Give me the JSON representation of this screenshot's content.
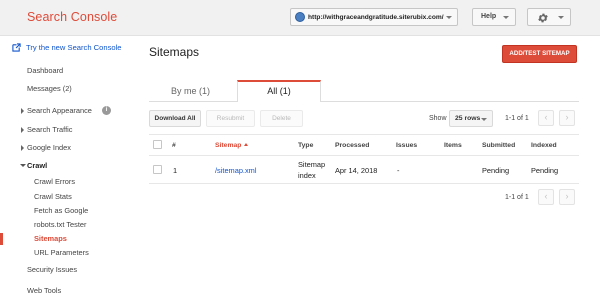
{
  "header": {
    "brand": "Search Console",
    "site_url": "http://withgraceandgratitude.siterubix.com/",
    "help_label": "Help"
  },
  "sidebar": {
    "try_new": "Try the new Search Console",
    "items": [
      {
        "label": "Dashboard"
      },
      {
        "label": "Messages (2)"
      },
      {
        "label": "Search Appearance"
      },
      {
        "label": "Search Traffic"
      },
      {
        "label": "Google Index"
      },
      {
        "label": "Crawl"
      },
      {
        "label": "Crawl Errors"
      },
      {
        "label": "Crawl Stats"
      },
      {
        "label": "Fetch as Google"
      },
      {
        "label": "robots.txt Tester"
      },
      {
        "label": "Sitemaps"
      },
      {
        "label": "URL Parameters"
      },
      {
        "label": "Security Issues"
      },
      {
        "label": "Web Tools"
      }
    ]
  },
  "main": {
    "title": "Sitemaps",
    "add_test_label": "ADD/TEST SITEMAP",
    "tabs": [
      {
        "label": "By me (1)"
      },
      {
        "label": "All (1)"
      }
    ],
    "toolbar": {
      "download_all": "Download All",
      "resubmit": "Resubmit",
      "delete": "Delete",
      "show_label": "Show",
      "rows_value": "25 rows",
      "pager_text": "1-1 of 1"
    },
    "table": {
      "columns": [
        "#",
        "Sitemap",
        "Type",
        "Processed",
        "Issues",
        "Items",
        "Submitted",
        "Indexed"
      ],
      "rows": [
        {
          "num": "1",
          "sitemap": "/sitemap.xml",
          "type_line1": "Sitemap",
          "type_line2": "index",
          "processed": "Apr 14, 2018",
          "issues": "-",
          "items": "",
          "submitted": "Pending",
          "indexed": "Pending"
        }
      ],
      "footer_pager_text": "1-1 of 1"
    }
  },
  "colors": {
    "accent": "#dd4b39",
    "link": "#1155cc",
    "header_bg": "#f1f1f1"
  },
  "icons": [
    "external-link-icon",
    "globe-icon",
    "gear-icon",
    "info-icon",
    "chevron-left-icon",
    "chevron-right-icon",
    "sort-ascending-icon"
  ]
}
